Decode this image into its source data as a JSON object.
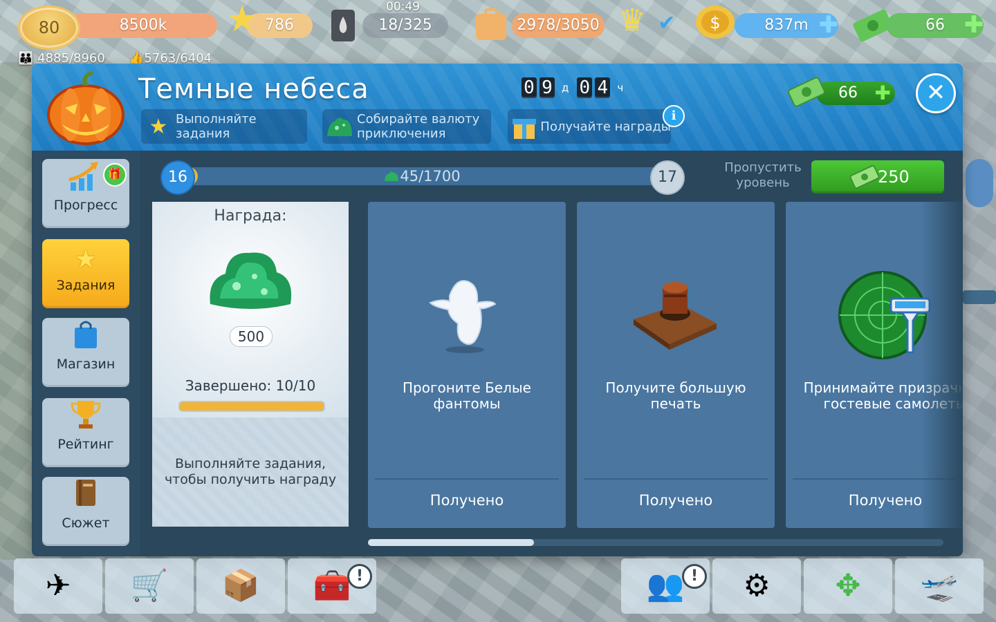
{
  "hud": {
    "level": "80",
    "xp": "8500k",
    "stars": "786",
    "fuel_time": "00:49",
    "fuel": "18/325",
    "cargo": "2978/3050",
    "coins": "837m",
    "cash": "66",
    "passengers": "4885/8960",
    "likes": "5763/6404"
  },
  "dialog": {
    "title": "Темные небеса",
    "timer": {
      "days": [
        "0",
        "9"
      ],
      "days_unit": "д",
      "hours": [
        "0",
        "4"
      ],
      "hours_unit": "ч"
    },
    "steps": [
      {
        "label": "Выполняйте задания",
        "icon": "star-icon"
      },
      {
        "label": "Собирайте валюту приключения",
        "icon": "green-slime-icon"
      },
      {
        "label": "Получайте награды",
        "icon": "gift-icon"
      }
    ],
    "cash": "66"
  },
  "sidebar": {
    "items": [
      {
        "label": "Прогресс",
        "icon": "progress-icon"
      },
      {
        "label": "Задания",
        "icon": "star-icon"
      },
      {
        "label": "Магазин",
        "icon": "shopping-bag-icon"
      },
      {
        "label": "Рейтинг",
        "icon": "trophy-icon"
      },
      {
        "label": "Сюжет",
        "icon": "book-icon"
      }
    ],
    "active": "Задания"
  },
  "progress": {
    "current_level": "16",
    "next_level": "17",
    "value_text": "45/1700",
    "value": 45,
    "max": 1700,
    "skip_label": "Пропустить уровень",
    "skip_cost": "250"
  },
  "reward": {
    "title": "Награда:",
    "amount": "500",
    "completed": "Завершено: 10/10",
    "hint": "Выполняйте задания, чтобы получить награду"
  },
  "tasks": [
    {
      "name": "Прогоните Белые фантомы",
      "status": "Получено",
      "icon": "ghost-icon"
    },
    {
      "name": "Получите большую печать",
      "status": "Получено",
      "icon": "stamp-icon"
    },
    {
      "name": "Принимайте призрачные гостевые самолеты",
      "status": "Получено",
      "icon": "radar-tower-icon"
    }
  ],
  "colors": {
    "header": "#1d7bc2",
    "panel": "#2d4b61",
    "task_card": "#4a76a0",
    "active_tab": "#f6a91b",
    "green_button": "#3fb62b"
  }
}
